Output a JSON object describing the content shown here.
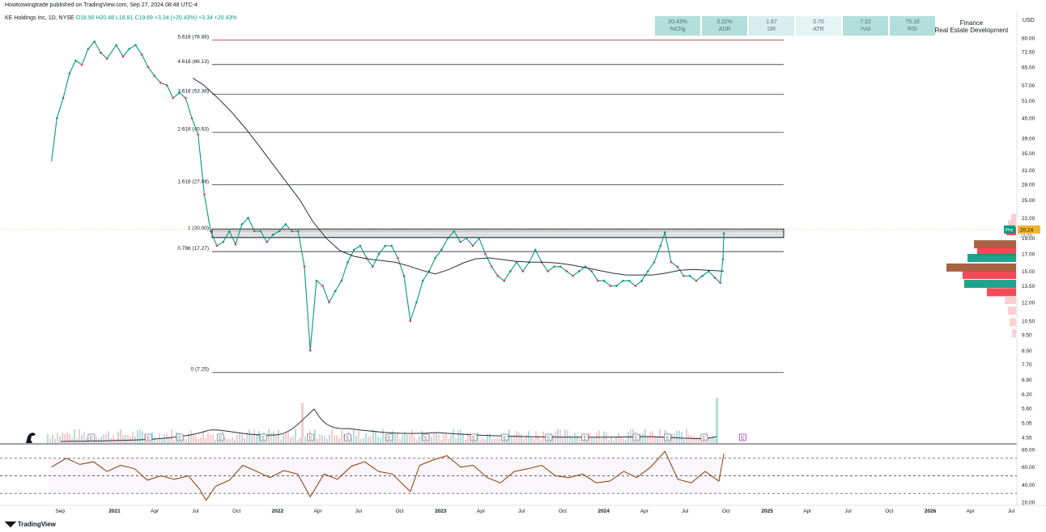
{
  "header": {
    "published": "Howtoswingtrade published on TradingView.com, Sep 27, 2024 08:48 UTC-4"
  },
  "legend": {
    "symbol": "KE Holdings Inc, 1D, NYSE",
    "open": "O18.90",
    "high": "H20.48",
    "low": "L18.81",
    "close": "C19.69",
    "change": "+3.34 (+20.43%)",
    "change_repeat": "+3.34 +20.43%"
  },
  "stats": [
    {
      "value": "20.43%",
      "label": "%Chg",
      "color": "#b2dfdb"
    },
    {
      "value": "3.22%",
      "label": "ADR",
      "color": "#b2dfdb"
    },
    {
      "value": "1.67",
      "label": "DR",
      "color": "#d6efec"
    },
    {
      "value": "0.70",
      "label": "ATR",
      "color": "#e4f4f2"
    },
    {
      "value": "7.22",
      "label": "rVol",
      "color": "#b2dfdb"
    },
    {
      "value": "75.16",
      "label": "RSI",
      "color": "#b2dfdb"
    }
  ],
  "sector": {
    "line1": "Finance",
    "line2": "Real Estate Development"
  },
  "currency": "USD",
  "price_badge": {
    "pre_label": "Pre",
    "value": "20.24",
    "last": "19.69"
  },
  "footer": {
    "brand": "TradingView"
  },
  "colors": {
    "up": "#089981",
    "down": "#f23645",
    "fib_top": "#b2474f",
    "rsi": "#8b3a00",
    "ma": "#2a2e39"
  },
  "chart_data": {
    "type": "line",
    "y_axis_labels": [
      "80.00",
      "72.50",
      "65.00",
      "57.00",
      "51.00",
      "45.00",
      "39.00",
      "35.00",
      "31.00",
      "28.00",
      "25.00",
      "22.00",
      "19.00",
      "17.00",
      "15.00",
      "13.50",
      "12.00",
      "10.50",
      "9.50",
      "8.50",
      "7.70",
      "6.90",
      "6.20",
      "5.60",
      "5.05",
      "4.55"
    ],
    "y_axis_values": [
      80,
      72.5,
      65,
      57,
      51,
      45,
      39,
      35,
      31,
      28,
      25,
      22,
      19,
      17,
      15,
      13.5,
      12,
      10.5,
      9.5,
      8.5,
      7.7,
      6.9,
      6.2,
      5.6,
      5.05,
      4.55
    ],
    "y_scale": "log",
    "x_axis_labels": [
      "Sep",
      "2021",
      "Apr",
      "Jul",
      "Oct",
      "2022",
      "Apr",
      "Jul",
      "Oct",
      "2023",
      "Apr",
      "Jul",
      "Oct",
      "2024",
      "Apr",
      "Jul",
      "Oct",
      "2025",
      "Apr",
      "Jul",
      "Oct",
      "2026",
      "Apr",
      "Jul"
    ],
    "fib_levels": [
      {
        "label": "5.618 (78.88)",
        "value": 78.88
      },
      {
        "label": "4.618 (66.13)",
        "value": 66.13
      },
      {
        "label": "3.618 (53.38)",
        "value": 53.38
      },
      {
        "label": "2.618 (40.63)",
        "value": 40.63
      },
      {
        "label": "1.618 (27.88)",
        "value": 27.88
      },
      {
        "label": "1 (20.00)",
        "value": 20.0
      },
      {
        "label": "0.786 (17.27)",
        "value": 17.27
      },
      {
        "label": "0 (7.25)",
        "value": 7.25
      }
    ],
    "resistance_zone": [
      19.1,
      20.3
    ],
    "price_series": [
      [
        "2020-08-13",
        33
      ],
      [
        "2020-08-25",
        45
      ],
      [
        "2020-09-08",
        52
      ],
      [
        "2020-09-22",
        62
      ],
      [
        "2020-10-06",
        68
      ],
      [
        "2020-10-20",
        66
      ],
      [
        "2020-11-03",
        74
      ],
      [
        "2020-11-17",
        78
      ],
      [
        "2020-12-01",
        72
      ],
      [
        "2020-12-15",
        69
      ],
      [
        "2021-01-05",
        76
      ],
      [
        "2021-01-20",
        70
      ],
      [
        "2021-02-03",
        74
      ],
      [
        "2021-02-17",
        76
      ],
      [
        "2021-03-03",
        71
      ],
      [
        "2021-03-17",
        65
      ],
      [
        "2021-03-31",
        61
      ],
      [
        "2021-04-14",
        58
      ],
      [
        "2021-04-28",
        57
      ],
      [
        "2021-05-12",
        52
      ],
      [
        "2021-05-26",
        54
      ],
      [
        "2021-06-09",
        52
      ],
      [
        "2021-06-23",
        45
      ],
      [
        "2021-07-07",
        40
      ],
      [
        "2021-07-21",
        26
      ],
      [
        "2021-08-04",
        20
      ],
      [
        "2021-08-18",
        18
      ],
      [
        "2021-09-01",
        18.5
      ],
      [
        "2021-09-15",
        20
      ],
      [
        "2021-09-29",
        18.2
      ],
      [
        "2021-10-13",
        21
      ],
      [
        "2021-10-27",
        22
      ],
      [
        "2021-11-10",
        20
      ],
      [
        "2021-11-24",
        20
      ],
      [
        "2021-12-08",
        18.5
      ],
      [
        "2021-12-22",
        19.5
      ],
      [
        "2022-01-05",
        20
      ],
      [
        "2022-01-19",
        21
      ],
      [
        "2022-02-02",
        20
      ],
      [
        "2022-02-16",
        20
      ],
      [
        "2022-03-02",
        15.5
      ],
      [
        "2022-03-15",
        8.5
      ],
      [
        "2022-03-29",
        14
      ],
      [
        "2022-04-12",
        13.5
      ],
      [
        "2022-04-26",
        12
      ],
      [
        "2022-05-10",
        13
      ],
      [
        "2022-05-24",
        14
      ],
      [
        "2022-06-07",
        16
      ],
      [
        "2022-06-21",
        17.5
      ],
      [
        "2022-07-05",
        18
      ],
      [
        "2022-07-19",
        16.5
      ],
      [
        "2022-08-02",
        15.5
      ],
      [
        "2022-08-16",
        17
      ],
      [
        "2022-08-30",
        18
      ],
      [
        "2022-09-13",
        18
      ],
      [
        "2022-09-27",
        16.5
      ],
      [
        "2022-10-11",
        14.5
      ],
      [
        "2022-10-25",
        10.5
      ],
      [
        "2022-11-08",
        12
      ],
      [
        "2022-11-22",
        14
      ],
      [
        "2022-12-06",
        15
      ],
      [
        "2022-12-20",
        16.5
      ],
      [
        "2023-01-03",
        17.5
      ],
      [
        "2023-01-17",
        19
      ],
      [
        "2023-01-31",
        20
      ],
      [
        "2023-02-14",
        18.5
      ],
      [
        "2023-02-28",
        19
      ],
      [
        "2023-03-14",
        18
      ],
      [
        "2023-03-28",
        19
      ],
      [
        "2023-04-11",
        17
      ],
      [
        "2023-04-25",
        15.5
      ],
      [
        "2023-05-09",
        14.5
      ],
      [
        "2023-05-23",
        14
      ],
      [
        "2023-06-06",
        15
      ],
      [
        "2023-06-20",
        16
      ],
      [
        "2023-07-04",
        15
      ],
      [
        "2023-07-18",
        16
      ],
      [
        "2023-08-01",
        17.5
      ],
      [
        "2023-08-15",
        16
      ],
      [
        "2023-08-29",
        15
      ],
      [
        "2023-09-12",
        15.5
      ],
      [
        "2023-09-26",
        15.5
      ],
      [
        "2023-10-10",
        15
      ],
      [
        "2023-10-24",
        14.5
      ],
      [
        "2023-11-07",
        15
      ],
      [
        "2023-11-21",
        15.5
      ],
      [
        "2023-12-05",
        15
      ],
      [
        "2023-12-19",
        14
      ],
      [
        "2024-01-02",
        14
      ],
      [
        "2024-01-16",
        13.5
      ],
      [
        "2024-01-30",
        13.5
      ],
      [
        "2024-02-13",
        14
      ],
      [
        "2024-02-27",
        14
      ],
      [
        "2024-03-12",
        13.5
      ],
      [
        "2024-03-26",
        14
      ],
      [
        "2024-04-09",
        15
      ],
      [
        "2024-04-23",
        16
      ],
      [
        "2024-05-07",
        18
      ],
      [
        "2024-05-17",
        19.8
      ],
      [
        "2024-05-31",
        16
      ],
      [
        "2024-06-14",
        15.5
      ],
      [
        "2024-06-28",
        14.5
      ],
      [
        "2024-07-12",
        14.5
      ],
      [
        "2024-07-26",
        14
      ],
      [
        "2024-08-09",
        14.5
      ],
      [
        "2024-08-23",
        15
      ],
      [
        "2024-09-06",
        14.3
      ],
      [
        "2024-09-18",
        13.8
      ],
      [
        "2024-09-24",
        16.35
      ],
      [
        "2024-09-26",
        19.69
      ]
    ],
    "ma_series": [
      [
        "2021-06-25",
        60
      ],
      [
        "2021-07-20",
        57
      ],
      [
        "2021-08-20",
        52
      ],
      [
        "2021-09-20",
        47
      ],
      [
        "2021-10-20",
        42
      ],
      [
        "2021-11-20",
        37
      ],
      [
        "2021-12-20",
        32.5
      ],
      [
        "2022-01-20",
        28.5
      ],
      [
        "2022-02-20",
        25
      ],
      [
        "2022-03-20",
        21.5
      ],
      [
        "2022-04-20",
        19
      ],
      [
        "2022-05-20",
        17.4
      ],
      [
        "2022-06-20",
        16.7
      ],
      [
        "2022-07-20",
        16.4
      ],
      [
        "2022-08-20",
        16.2
      ],
      [
        "2022-09-20",
        16
      ],
      [
        "2022-10-20",
        15.6
      ],
      [
        "2022-11-20",
        15.1
      ],
      [
        "2022-12-20",
        14.7
      ],
      [
        "2023-01-20",
        15.2
      ],
      [
        "2023-02-20",
        15.9
      ],
      [
        "2023-03-20",
        16.4
      ],
      [
        "2023-04-20",
        16.5
      ],
      [
        "2023-05-20",
        16.3
      ],
      [
        "2023-06-20",
        16.1
      ],
      [
        "2023-07-20",
        16
      ],
      [
        "2023-08-20",
        16
      ],
      [
        "2023-09-20",
        15.9
      ],
      [
        "2023-10-20",
        15.7
      ],
      [
        "2023-11-20",
        15.4
      ],
      [
        "2023-12-20",
        15.1
      ],
      [
        "2024-01-20",
        14.8
      ],
      [
        "2024-02-20",
        14.6
      ],
      [
        "2024-03-20",
        14.6
      ],
      [
        "2024-04-20",
        14.6
      ],
      [
        "2024-05-20",
        14.8
      ],
      [
        "2024-06-20",
        15.1
      ],
      [
        "2024-07-20",
        15.2
      ],
      [
        "2024-08-20",
        15.1
      ],
      [
        "2024-09-26",
        15
      ]
    ],
    "earnings_dates": [
      "2020-11-10",
      "2021-03-18",
      "2021-05-27",
      "2021-08-26",
      "2021-11-30",
      "2022-03-16",
      "2022-06-07",
      "2022-09-08",
      "2022-11-29",
      "2023-03-16",
      "2023-05-25",
      "2023-08-31",
      "2023-11-20",
      "2024-03-14",
      "2024-05-23",
      "2024-08-13",
      "2024-11-07"
    ],
    "rsi": {
      "value": 75.16,
      "axis_labels": [
        "80.00",
        "60.00",
        "40.00",
        "20.00"
      ],
      "axis_values": [
        80,
        60,
        40,
        20
      ],
      "levels": [
        70,
        50,
        30
      ],
      "series": [
        [
          "2020-08-13",
          60
        ],
        [
          "2020-09-15",
          70
        ],
        [
          "2020-10-15",
          63
        ],
        [
          "2020-11-15",
          66
        ],
        [
          "2020-12-15",
          55
        ],
        [
          "2021-01-15",
          62
        ],
        [
          "2021-02-15",
          58
        ],
        [
          "2021-03-15",
          45
        ],
        [
          "2021-04-15",
          50
        ],
        [
          "2021-05-15",
          46
        ],
        [
          "2021-06-15",
          50
        ],
        [
          "2021-07-10",
          35
        ],
        [
          "2021-07-25",
          22
        ],
        [
          "2021-08-15",
          38
        ],
        [
          "2021-09-15",
          45
        ],
        [
          "2021-10-15",
          62
        ],
        [
          "2021-11-15",
          55
        ],
        [
          "2021-12-15",
          48
        ],
        [
          "2022-01-15",
          56
        ],
        [
          "2022-02-15",
          52
        ],
        [
          "2022-03-15",
          26
        ],
        [
          "2022-04-15",
          52
        ],
        [
          "2022-05-15",
          46
        ],
        [
          "2022-06-15",
          61
        ],
        [
          "2022-07-15",
          66
        ],
        [
          "2022-08-15",
          55
        ],
        [
          "2022-09-15",
          52
        ],
        [
          "2022-10-25",
          32
        ],
        [
          "2022-11-15",
          62
        ],
        [
          "2022-12-15",
          68
        ],
        [
          "2023-01-15",
          73
        ],
        [
          "2023-02-15",
          60
        ],
        [
          "2023-03-15",
          62
        ],
        [
          "2023-04-15",
          48
        ],
        [
          "2023-05-15",
          42
        ],
        [
          "2023-06-15",
          55
        ],
        [
          "2023-07-15",
          58
        ],
        [
          "2023-08-15",
          62
        ],
        [
          "2023-09-15",
          50
        ],
        [
          "2023-10-15",
          48
        ],
        [
          "2023-11-15",
          52
        ],
        [
          "2023-12-15",
          42
        ],
        [
          "2024-01-15",
          44
        ],
        [
          "2024-02-15",
          55
        ],
        [
          "2024-03-15",
          48
        ],
        [
          "2024-04-15",
          60
        ],
        [
          "2024-05-17",
          78
        ],
        [
          "2024-06-15",
          46
        ],
        [
          "2024-07-15",
          42
        ],
        [
          "2024-08-15",
          55
        ],
        [
          "2024-09-15",
          44
        ],
        [
          "2024-09-26",
          75.16
        ]
      ]
    }
  }
}
